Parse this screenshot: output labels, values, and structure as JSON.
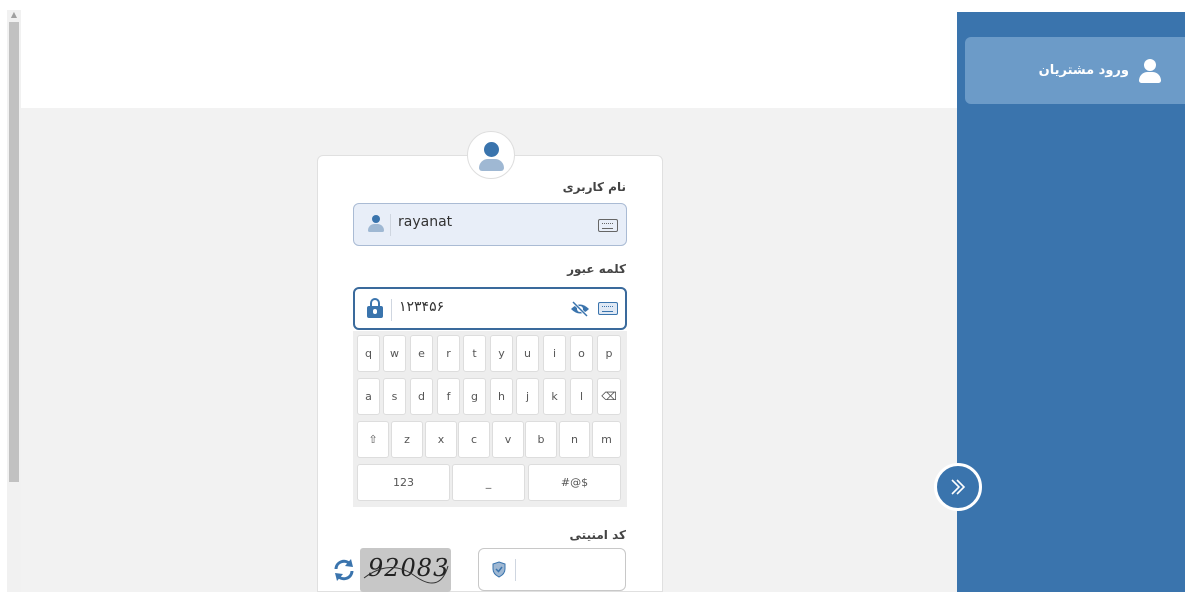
{
  "sidebar": {
    "item_label": "ورود مشتریان",
    "item_icon": "user-icon",
    "collapse_icon": "double-chevron-right-icon"
  },
  "login": {
    "avatar_icon": "user-avatar-icon",
    "username_label": "نام کاربری",
    "username_value": "rayanat",
    "password_label": "کلمه عبور",
    "password_value": "۱۲۳۴۵۶",
    "captcha_label": "کد امنیتی",
    "captcha_image_text": "92083",
    "captcha_value": ""
  },
  "keyboard": {
    "row1": [
      "q",
      "w",
      "e",
      "r",
      "t",
      "y",
      "u",
      "i",
      "o",
      "p"
    ],
    "row2": [
      "a",
      "s",
      "d",
      "f",
      "g",
      "h",
      "j",
      "k",
      "l",
      "⌫"
    ],
    "row3": [
      "⇧",
      "z",
      "x",
      "c",
      "v",
      "b",
      "n",
      "m"
    ],
    "row4": [
      "123",
      "_",
      "#@$"
    ]
  },
  "colors": {
    "accent": "#3a74ad",
    "sidebar_bg": "#3a74ad",
    "sidebar_item_bg": "#6c9bc8",
    "page_bg": "#f2f2f2"
  }
}
